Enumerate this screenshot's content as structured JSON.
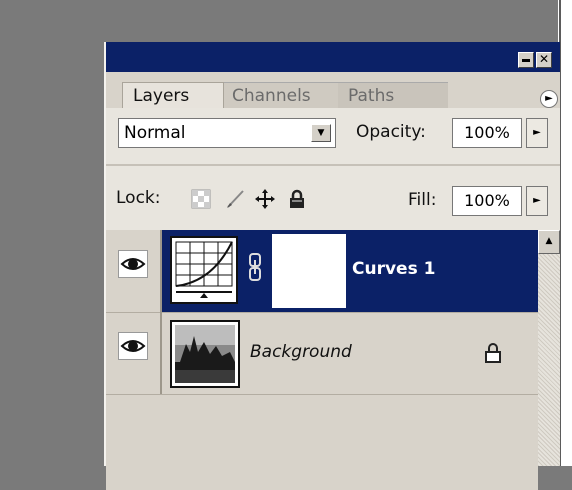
{
  "panel": {
    "tabs": [
      {
        "label": "Layers",
        "active": true
      },
      {
        "label": "Channels",
        "active": false
      },
      {
        "label": "Paths",
        "active": false
      }
    ],
    "blend_mode": "Normal",
    "opacity_label": "Opacity:",
    "opacity_value": "100%",
    "lock_label": "Lock:",
    "fill_label": "Fill:",
    "fill_value": "100%",
    "layers": [
      {
        "name": "Curves 1",
        "selected": true,
        "type": "adjustment-curves",
        "visible": true
      },
      {
        "name": "Background",
        "selected": false,
        "type": "image",
        "visible": true,
        "locked": true
      }
    ],
    "colors": {
      "titlebar": "#0b2167",
      "selected_row": "#0b2167",
      "panel_bg": "#d8d3ca"
    }
  }
}
